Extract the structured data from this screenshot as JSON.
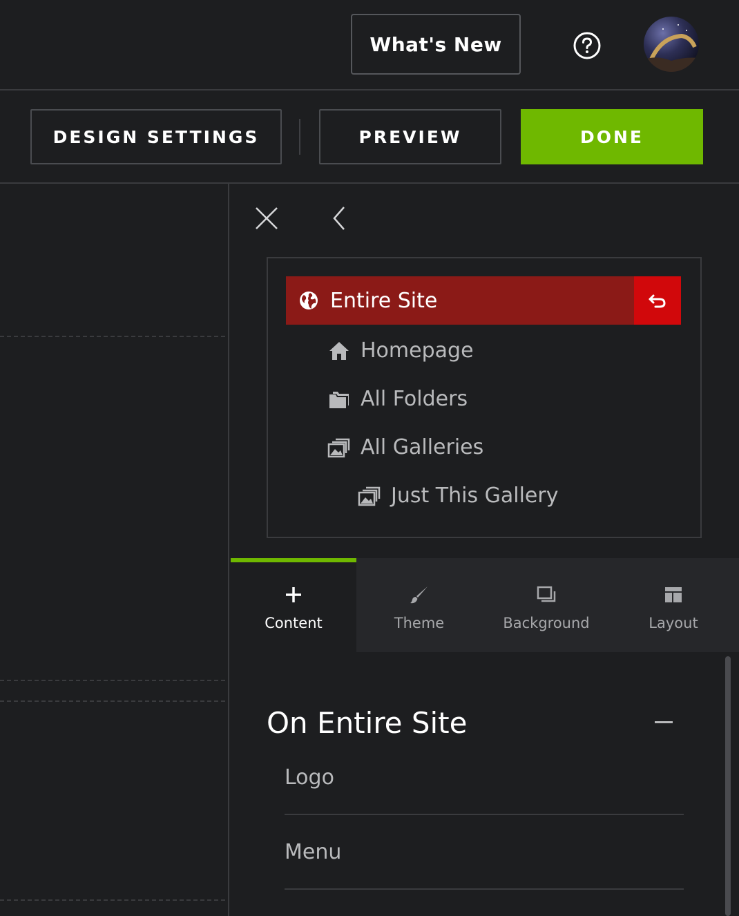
{
  "header": {
    "whats_new_label": "What's New",
    "help_icon": "question-circle-icon",
    "avatar_alt": "user-avatar"
  },
  "toolbar": {
    "design_settings_label": "DESIGN SETTINGS",
    "preview_label": "PREVIEW",
    "done_label": "DONE",
    "done_color": "#6fb800"
  },
  "panel": {
    "close_icon": "close-icon",
    "back_icon": "chevron-left-icon",
    "scope": {
      "selected": {
        "label": "Entire Site",
        "icon": "globe-icon",
        "color": "#8b1a17",
        "reset_color": "#d1080b"
      },
      "items": [
        {
          "label": "Homepage",
          "icon": "home-icon"
        },
        {
          "label": "All Folders",
          "icon": "folders-icon"
        },
        {
          "label": "All Galleries",
          "icon": "galleries-icon"
        },
        {
          "label": "Just This Gallery",
          "icon": "gallery-icon"
        }
      ]
    },
    "tabs": [
      {
        "label": "Content",
        "icon": "plus-icon",
        "active": true
      },
      {
        "label": "Theme",
        "icon": "brush-icon",
        "active": false
      },
      {
        "label": "Background",
        "icon": "background-icon",
        "active": false
      },
      {
        "label": "Layout",
        "icon": "layout-icon",
        "active": false
      }
    ],
    "section": {
      "title": "On Entire Site",
      "items": [
        {
          "label": "Logo"
        },
        {
          "label": "Menu"
        }
      ]
    }
  }
}
